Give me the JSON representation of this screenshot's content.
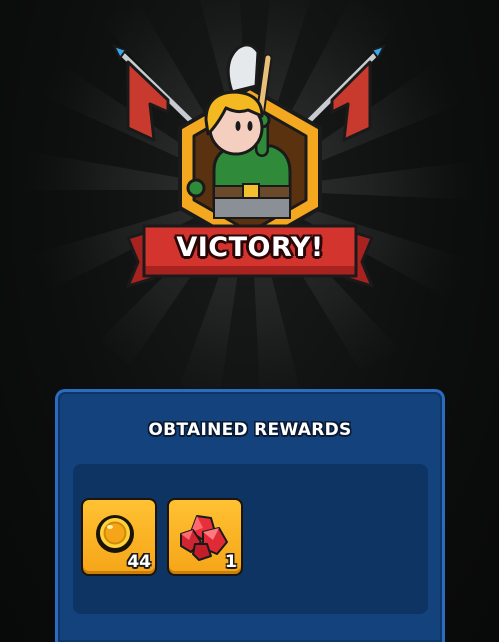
{
  "banner": {
    "title": "VICTORY!"
  },
  "rewards_panel": {
    "title": "OBTAINED REWARDS",
    "items": [
      {
        "icon": "gold-coin-icon",
        "count": "44"
      },
      {
        "icon": "red-gem-icon",
        "count": "1"
      }
    ]
  },
  "colors": {
    "background": "#0b0c0c",
    "panel": "#13427c",
    "panel_border": "#2b6cc0",
    "ribbon": "#d3342e",
    "emblem_gold": "#f4a820",
    "reward_slot": "#f5a518"
  }
}
